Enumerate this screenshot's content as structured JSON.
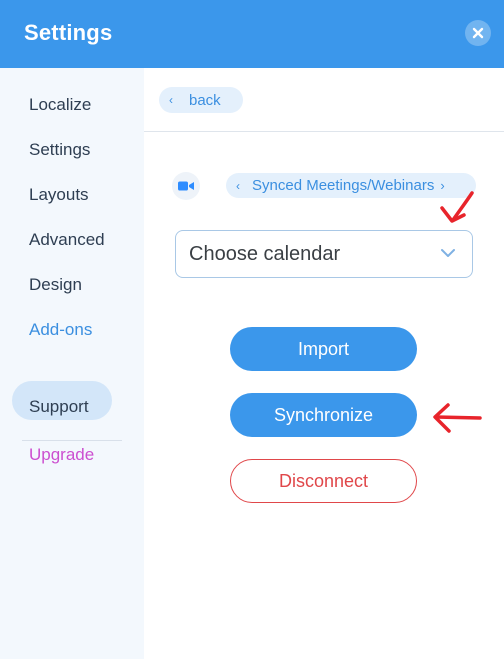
{
  "header": {
    "title": "Settings",
    "close_icon": "close-icon"
  },
  "sidebar": {
    "items": [
      {
        "label": "Localize"
      },
      {
        "label": "Settings"
      },
      {
        "label": "Layouts"
      },
      {
        "label": "Advanced"
      },
      {
        "label": "Design"
      },
      {
        "label": "Add-ons",
        "active": true
      },
      {
        "label": "Support"
      },
      {
        "label": "Upgrade"
      }
    ]
  },
  "content": {
    "back_label": "back",
    "integration_icon": "video-camera-icon",
    "breadcrumb": "Synced Meetings/Webinars",
    "calendar_select": {
      "value": "Choose calendar"
    },
    "buttons": {
      "import": "Import",
      "synchronize": "Synchronize",
      "disconnect": "Disconnect"
    }
  },
  "colors": {
    "accent": "#3b97eb",
    "sidebar_bg": "#f3f8fd",
    "danger": "#e0474a",
    "upgrade": "#cc4fd0",
    "annotation": "#e8242b"
  }
}
